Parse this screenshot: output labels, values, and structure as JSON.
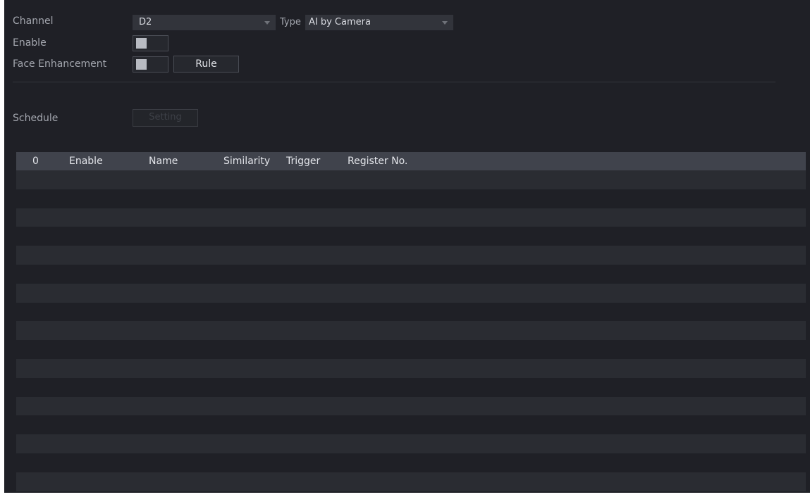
{
  "fields": {
    "channel_label": "Channel",
    "channel_value": "D2",
    "type_label": "Type",
    "type_value": "AI by Camera",
    "enable_label": "Enable",
    "face_enhancement_label": "Face Enhancement",
    "rule_button": "Rule",
    "schedule_label": "Schedule",
    "setting_button": "Setting"
  },
  "toggles": {
    "enable": "off",
    "face_enhancement": "off"
  },
  "table": {
    "columns": [
      "0",
      "Enable",
      "Name",
      "Similarity",
      "Trigger",
      "Register No."
    ],
    "rows": []
  },
  "colors": {
    "background": "#1f2026",
    "header": "#40434c",
    "row_alt": "#2a2c32",
    "text": "#dadce2",
    "muted": "#a3a6ae"
  }
}
